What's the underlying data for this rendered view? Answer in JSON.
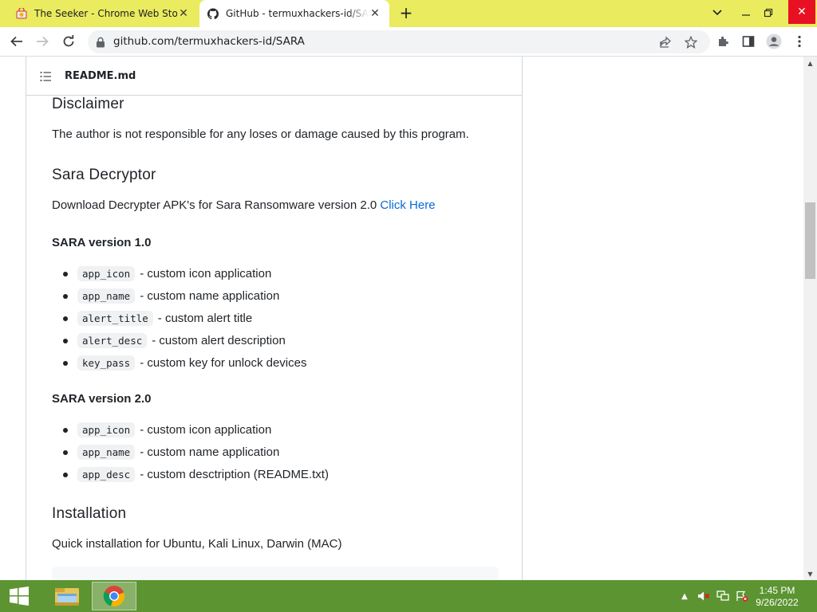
{
  "browser": {
    "tabs": [
      {
        "title": "The Seeker - Chrome Web Store",
        "icon": "chrome-web-store-icon",
        "active": false
      },
      {
        "title": "GitHub - termuxhackers-id/SARA",
        "icon": "github-icon",
        "active": true
      }
    ],
    "url": "github.com/termuxhackers-id/SARA"
  },
  "readme": {
    "filename": "README.md",
    "disclaimer": {
      "heading": "Disclaimer",
      "text": "The author is not responsible for any loses or damage caused by this program."
    },
    "decryptor": {
      "heading": "Sara Decryptor",
      "text": "Download Decrypter APK's for Sara Ransomware version 2.0",
      "link": "Click Here"
    },
    "v1": {
      "heading": "SARA version 1.0",
      "items": [
        {
          "code": "app_icon",
          "desc": "- custom icon application"
        },
        {
          "code": "app_name",
          "desc": "- custom name application"
        },
        {
          "code": "alert_title",
          "desc": "- custom alert title"
        },
        {
          "code": "alert_desc",
          "desc": "- custom alert description"
        },
        {
          "code": "key_pass",
          "desc": "- custom key for unlock devices"
        }
      ]
    },
    "v2": {
      "heading": "SARA version 2.0",
      "items": [
        {
          "code": "app_icon",
          "desc": "- custom icon application"
        },
        {
          "code": "app_name",
          "desc": "- custom name application"
        },
        {
          "code": "app_desc",
          "desc": "- custom desctription (README.txt)"
        }
      ]
    },
    "installation": {
      "heading": "Installation",
      "text": "Quick installation for Ubuntu, Kali Linux, Darwin (MAC)"
    }
  },
  "taskbar": {
    "time": "1:45 PM",
    "date": "9/26/2022"
  },
  "colors": {
    "tabstrip": "#eaeb5e",
    "taskbar": "#5c9431",
    "link": "#0969da"
  }
}
